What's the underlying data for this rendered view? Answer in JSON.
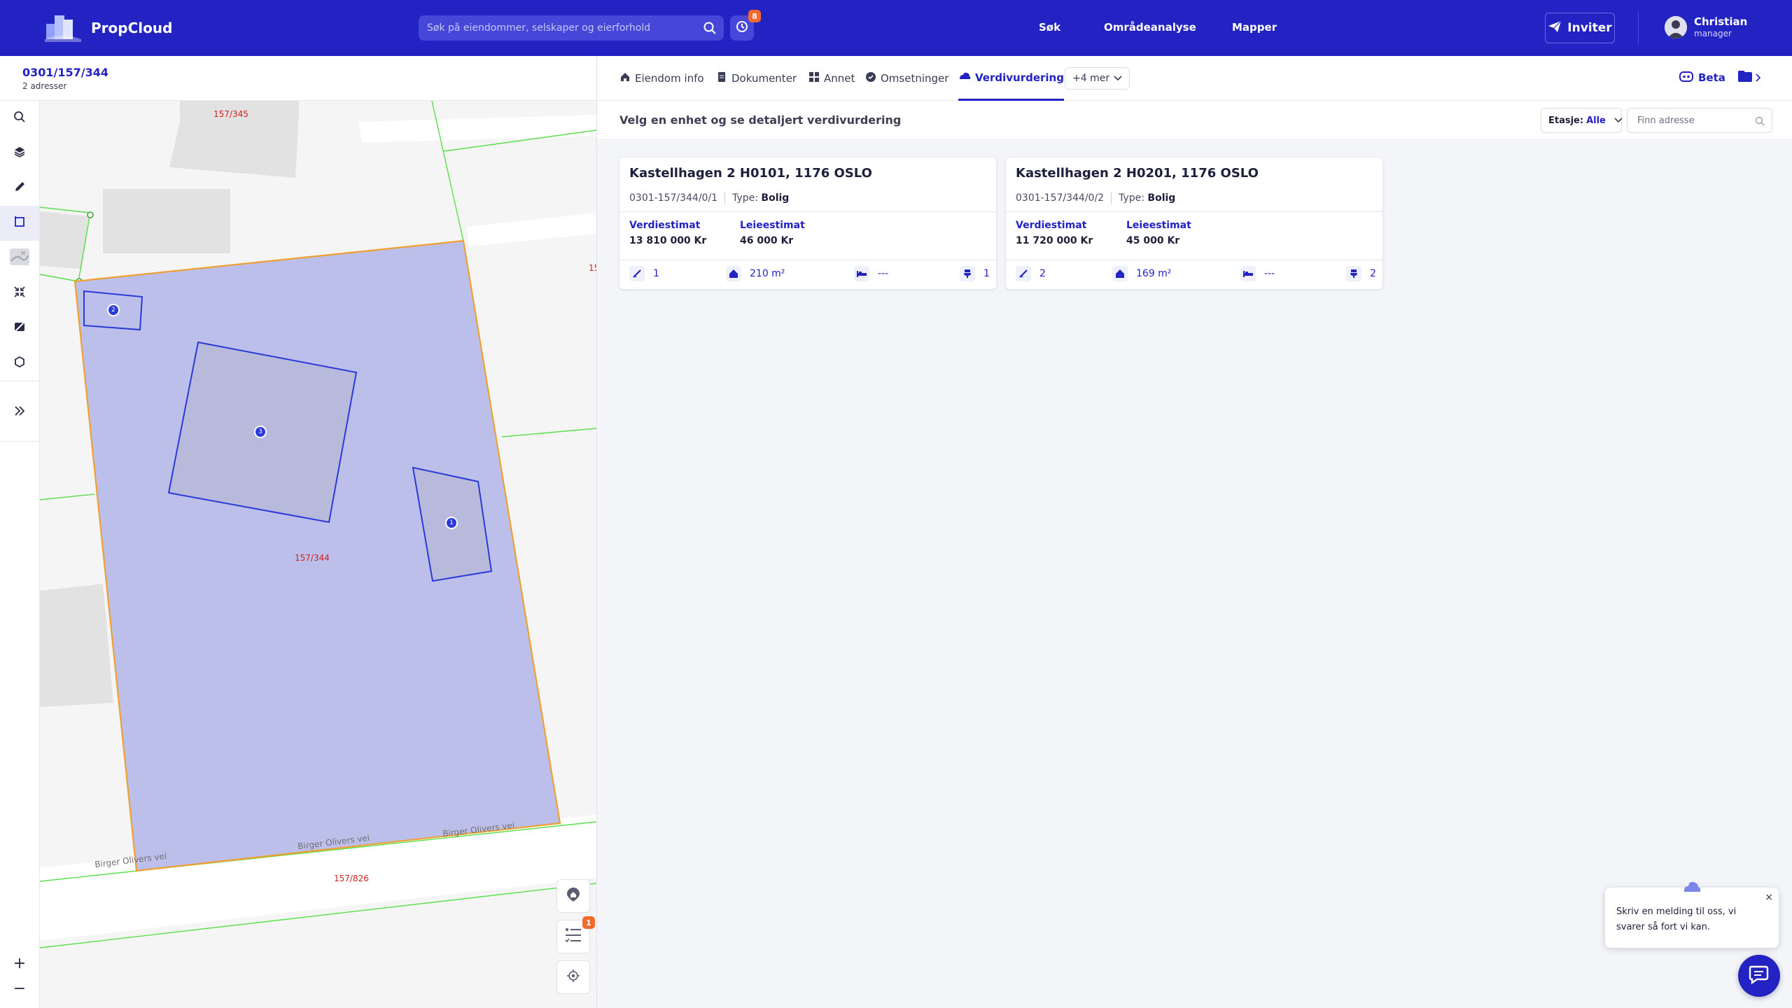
{
  "app": {
    "name": "PropCloud"
  },
  "search": {
    "placeholder": "Søk på eiendommer, selskaper og eierforhold"
  },
  "history": {
    "badge": "8"
  },
  "nav": {
    "items": [
      "Søk",
      "Områdeanalyse",
      "Mapper"
    ]
  },
  "invite": {
    "label": "Inviter"
  },
  "user": {
    "name": "Christian",
    "role": "manager"
  },
  "property": {
    "id": "0301/157/344",
    "addresses": "2 adresser"
  },
  "tabs": {
    "items": [
      "Eiendom info",
      "Dokumenter",
      "Annet",
      "Omsetninger",
      "Verdivurdering"
    ],
    "active": "Verdivurdering",
    "more": "+4 mer",
    "beta": "Beta"
  },
  "valuation": {
    "heading": "Velg en enhet og se detaljert verdivurdering",
    "floor_label": "Etasje:",
    "floor_value": "Alle",
    "address_placeholder": "Finn adresse",
    "units": [
      {
        "title": "Kastellhagen 2 H0101, 1176 OSLO",
        "id": "0301-157/344/0/1",
        "type_label": "Type:",
        "type": "Bolig",
        "value_label": "Verdiestimat",
        "value": "13 810 000 Kr",
        "rent_label": "Leieestimat",
        "rent": "46 000 Kr",
        "rooms": "1",
        "area": "210 m²",
        "bedrooms": "---",
        "bathrooms": "1"
      },
      {
        "title": "Kastellhagen 2 H0201, 1176 OSLO",
        "id": "0301-157/344/0/2",
        "type_label": "Type:",
        "type": "Bolig",
        "value_label": "Verdiestimat",
        "value": "11 720 000 Kr",
        "rent_label": "Leieestimat",
        "rent": "45 000 Kr",
        "rooms": "2",
        "area": "169 m²",
        "bedrooms": "---",
        "bathrooms": "2"
      }
    ]
  },
  "map": {
    "parcels": [
      "157/345",
      "157/344",
      "157/826",
      "15"
    ],
    "roads": [
      "Birger Olivers vei",
      "Birger Olivers vei",
      "Birger Olivers vei"
    ],
    "markers": [
      "2",
      "3",
      "1"
    ],
    "list_badge": "1",
    "zoom_in": "+",
    "zoom_out": "−"
  },
  "chat": {
    "message": "Skriv en melding til oss, vi svarer så fort vi kan.",
    "close": "×"
  },
  "colors": {
    "brand": "#2323c4",
    "accent": "#ef6c2e",
    "parcel_fill": "#bcbfea",
    "parcel_border": "#f0a030",
    "building": "#2a3ad8",
    "parcel_label": "#d0221f",
    "boundary": "#58e048"
  },
  "icons": [
    "logo-icon",
    "search-icon",
    "history-icon",
    "send-icon",
    "avatar",
    "home-icon",
    "document-icon",
    "grid-icon",
    "coin-icon",
    "valuation-icon",
    "chevron-down-icon",
    "bot-icon",
    "folder-icon",
    "chevron-right-icon",
    "layers-icon",
    "pencil-icon",
    "select-icon",
    "satellite-icon",
    "compress-icon",
    "image-off-icon",
    "hexagon-icon",
    "double-chevron-icon",
    "ruler-icon",
    "house-icon",
    "bed-icon",
    "toilet-icon",
    "marker-icon",
    "list-icon",
    "locate-icon",
    "chat-icon"
  ]
}
